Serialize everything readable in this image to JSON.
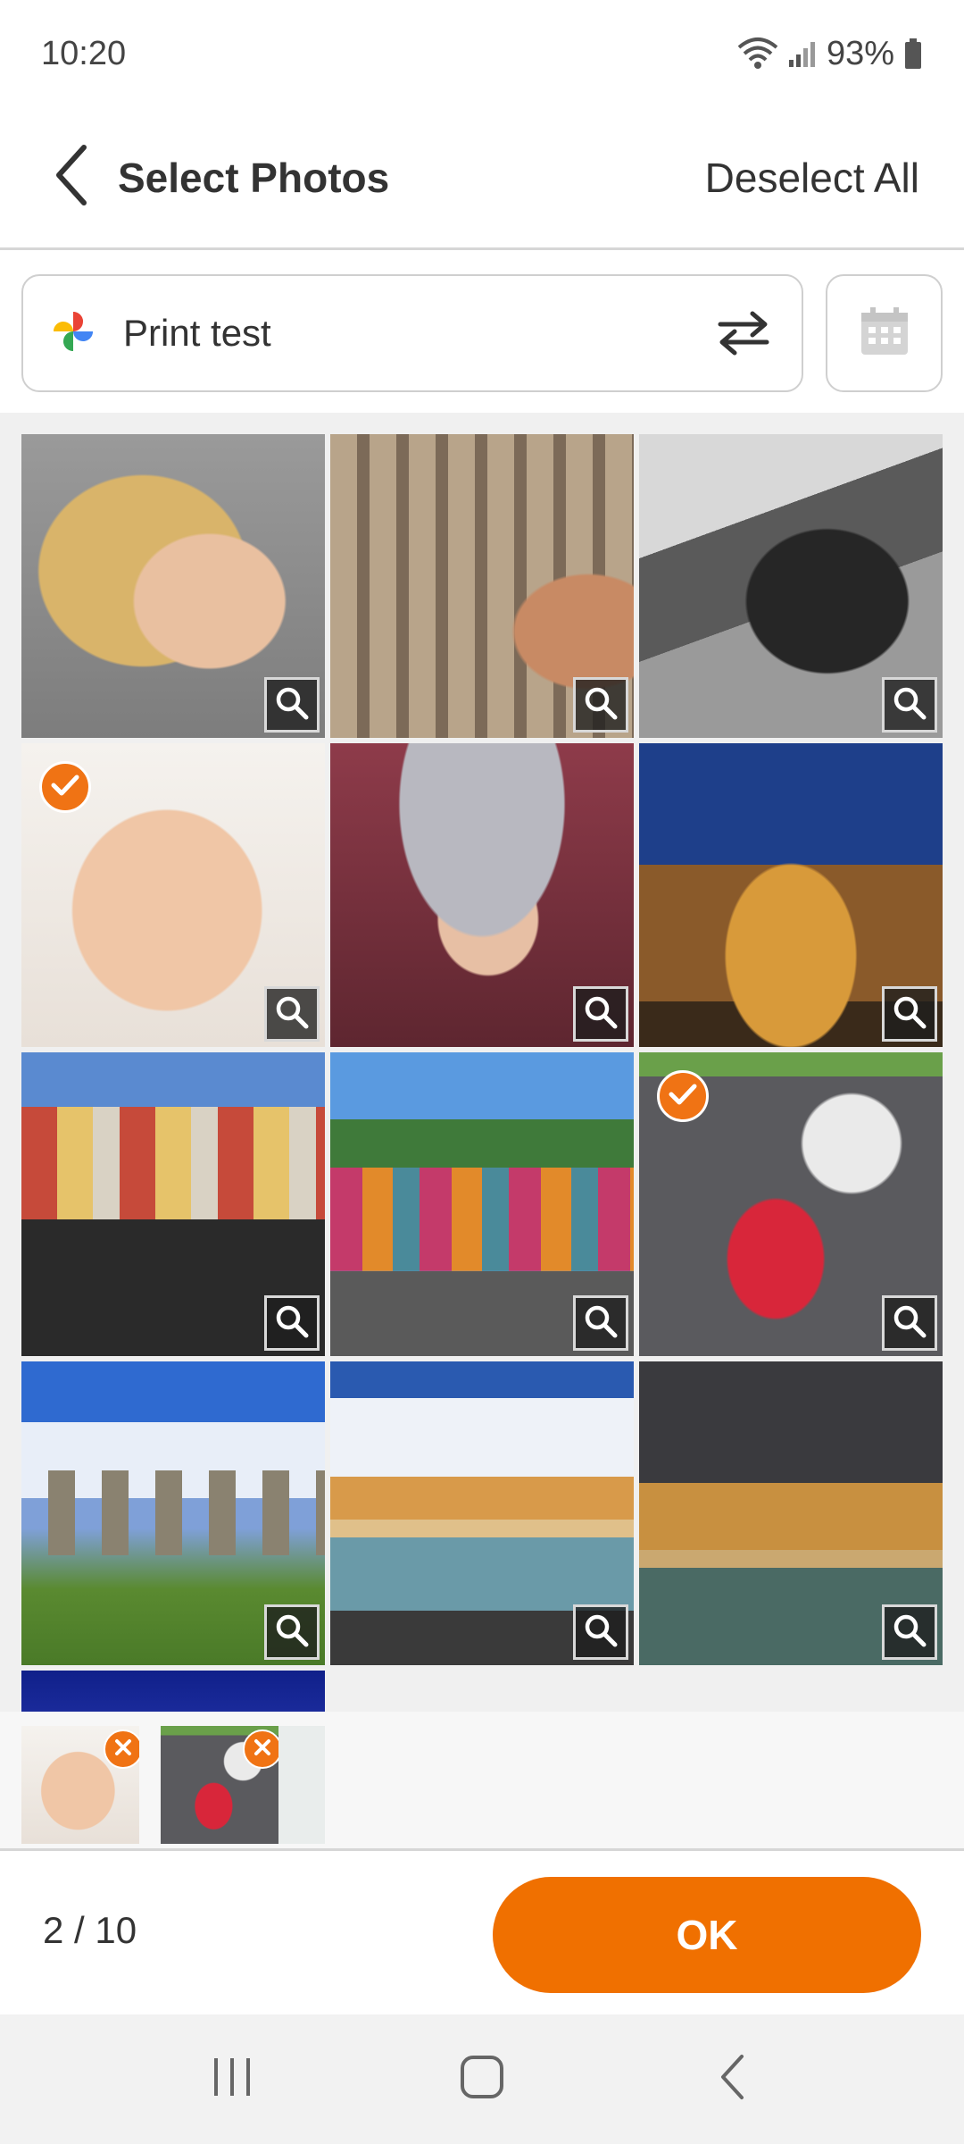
{
  "status_bar": {
    "time": "10:20",
    "battery": "93%"
  },
  "header": {
    "title": "Select Photos",
    "deselect_label": "Deselect All"
  },
  "album": {
    "name": "Print test"
  },
  "photos": [
    {
      "name": "woman-portrait",
      "selected": false
    },
    {
      "name": "gallery-painting",
      "selected": false
    },
    {
      "name": "steam-train",
      "selected": false
    },
    {
      "name": "baby-face",
      "selected": true
    },
    {
      "name": "woman-in-hat",
      "selected": false
    },
    {
      "name": "lit-palace",
      "selected": false
    },
    {
      "name": "harbor-houses",
      "selected": false
    },
    {
      "name": "graffiti-shack",
      "selected": false
    },
    {
      "name": "motorcycle-race",
      "selected": true
    },
    {
      "name": "stonehenge",
      "selected": false
    },
    {
      "name": "beach-cliff-sunny",
      "selected": false
    },
    {
      "name": "beach-cliff-stormy",
      "selected": false
    }
  ],
  "footer": {
    "count": "2 / 10",
    "ok_label": "OK"
  },
  "colors": {
    "accent": "#f07000"
  }
}
